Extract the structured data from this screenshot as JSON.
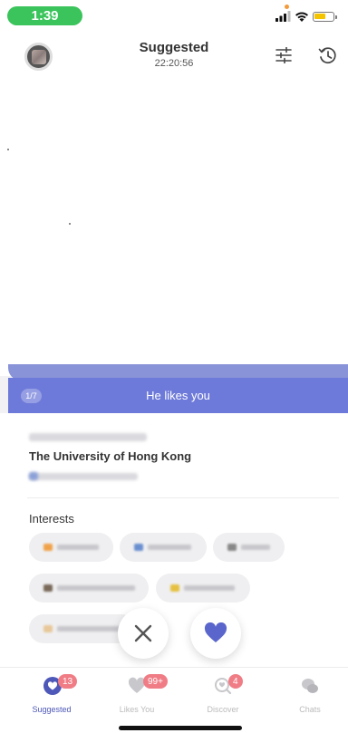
{
  "status_bar": {
    "time": "1:39"
  },
  "header": {
    "title": "Suggested",
    "subtitle": "22:20:56"
  },
  "likes_banner": {
    "counter": "1/7",
    "text": "He likes you"
  },
  "profile": {
    "university": "The University of Hong Kong"
  },
  "interests": {
    "label": "Interests"
  },
  "tabs": [
    {
      "label": "Suggested",
      "badge": "13"
    },
    {
      "label": "Likes You",
      "badge": "99+"
    },
    {
      "label": "Discover",
      "badge": "4"
    },
    {
      "label": "Chats",
      "badge": ""
    }
  ],
  "colors": {
    "accent": "#6e7ad9",
    "badge": "#f07d86",
    "time_pill": "#3ac45b",
    "like_heart": "#5a66cc"
  }
}
